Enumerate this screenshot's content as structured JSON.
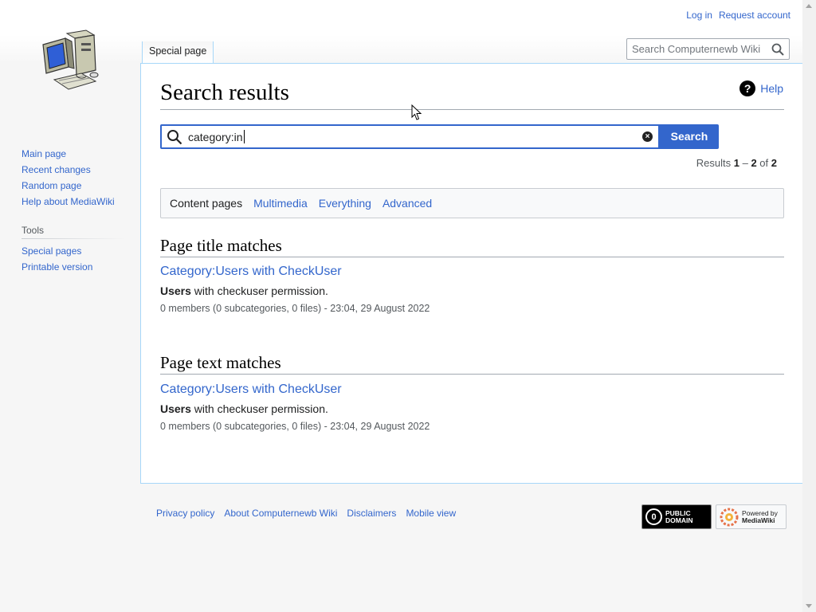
{
  "personal": {
    "login": "Log in",
    "request_account": "Request account"
  },
  "header": {
    "tab_special": "Special page",
    "search_placeholder": "Search Computernewb Wiki"
  },
  "sidebar": {
    "nav": [
      "Main page",
      "Recent changes",
      "Random page",
      "Help about MediaWiki"
    ],
    "tools_heading": "Tools",
    "tools": [
      "Special pages",
      "Printable version"
    ]
  },
  "content": {
    "title": "Search results",
    "help": "Help",
    "search_value": "category:in",
    "search_button": "Search",
    "results_info": {
      "prefix": "Results ",
      "from": "1",
      "dash": " – ",
      "to": "2",
      "of": " of ",
      "total": "2"
    },
    "profile_tabs": [
      "Content pages",
      "Multimedia",
      "Everything",
      "Advanced"
    ],
    "sections": [
      {
        "heading": "Page title matches",
        "result": {
          "title": "Category:Users with CheckUser",
          "snippet_bold": "Users",
          "snippet_rest": " with checkuser permission.",
          "meta": "0 members (0 subcategories, 0 files) - 23:04, 29 August 2022"
        }
      },
      {
        "heading": "Page text matches",
        "result": {
          "title": "Category:Users with CheckUser",
          "snippet_bold": "Users",
          "snippet_rest": " with checkuser permission.",
          "meta": "0 members (0 subcategories, 0 files) - 23:04, 29 August 2022"
        }
      }
    ]
  },
  "footer": {
    "links": [
      "Privacy policy",
      "About Computernewb Wiki",
      "Disclaimers",
      "Mobile view"
    ],
    "badge_pd": {
      "line1": "PUBLIC",
      "line2": "DOMAIN"
    },
    "badge_mw": {
      "line1": "Powered by",
      "line2": "MediaWiki"
    }
  },
  "colors": {
    "link": "#3366cc",
    "accent": "#3366cc",
    "border": "#a7d7f9"
  },
  "icons": [
    "computer-logo-icon",
    "search-icon",
    "help-icon",
    "clear-icon",
    "public-domain-icon",
    "mediawiki-icon",
    "mouse-cursor-icon"
  ]
}
